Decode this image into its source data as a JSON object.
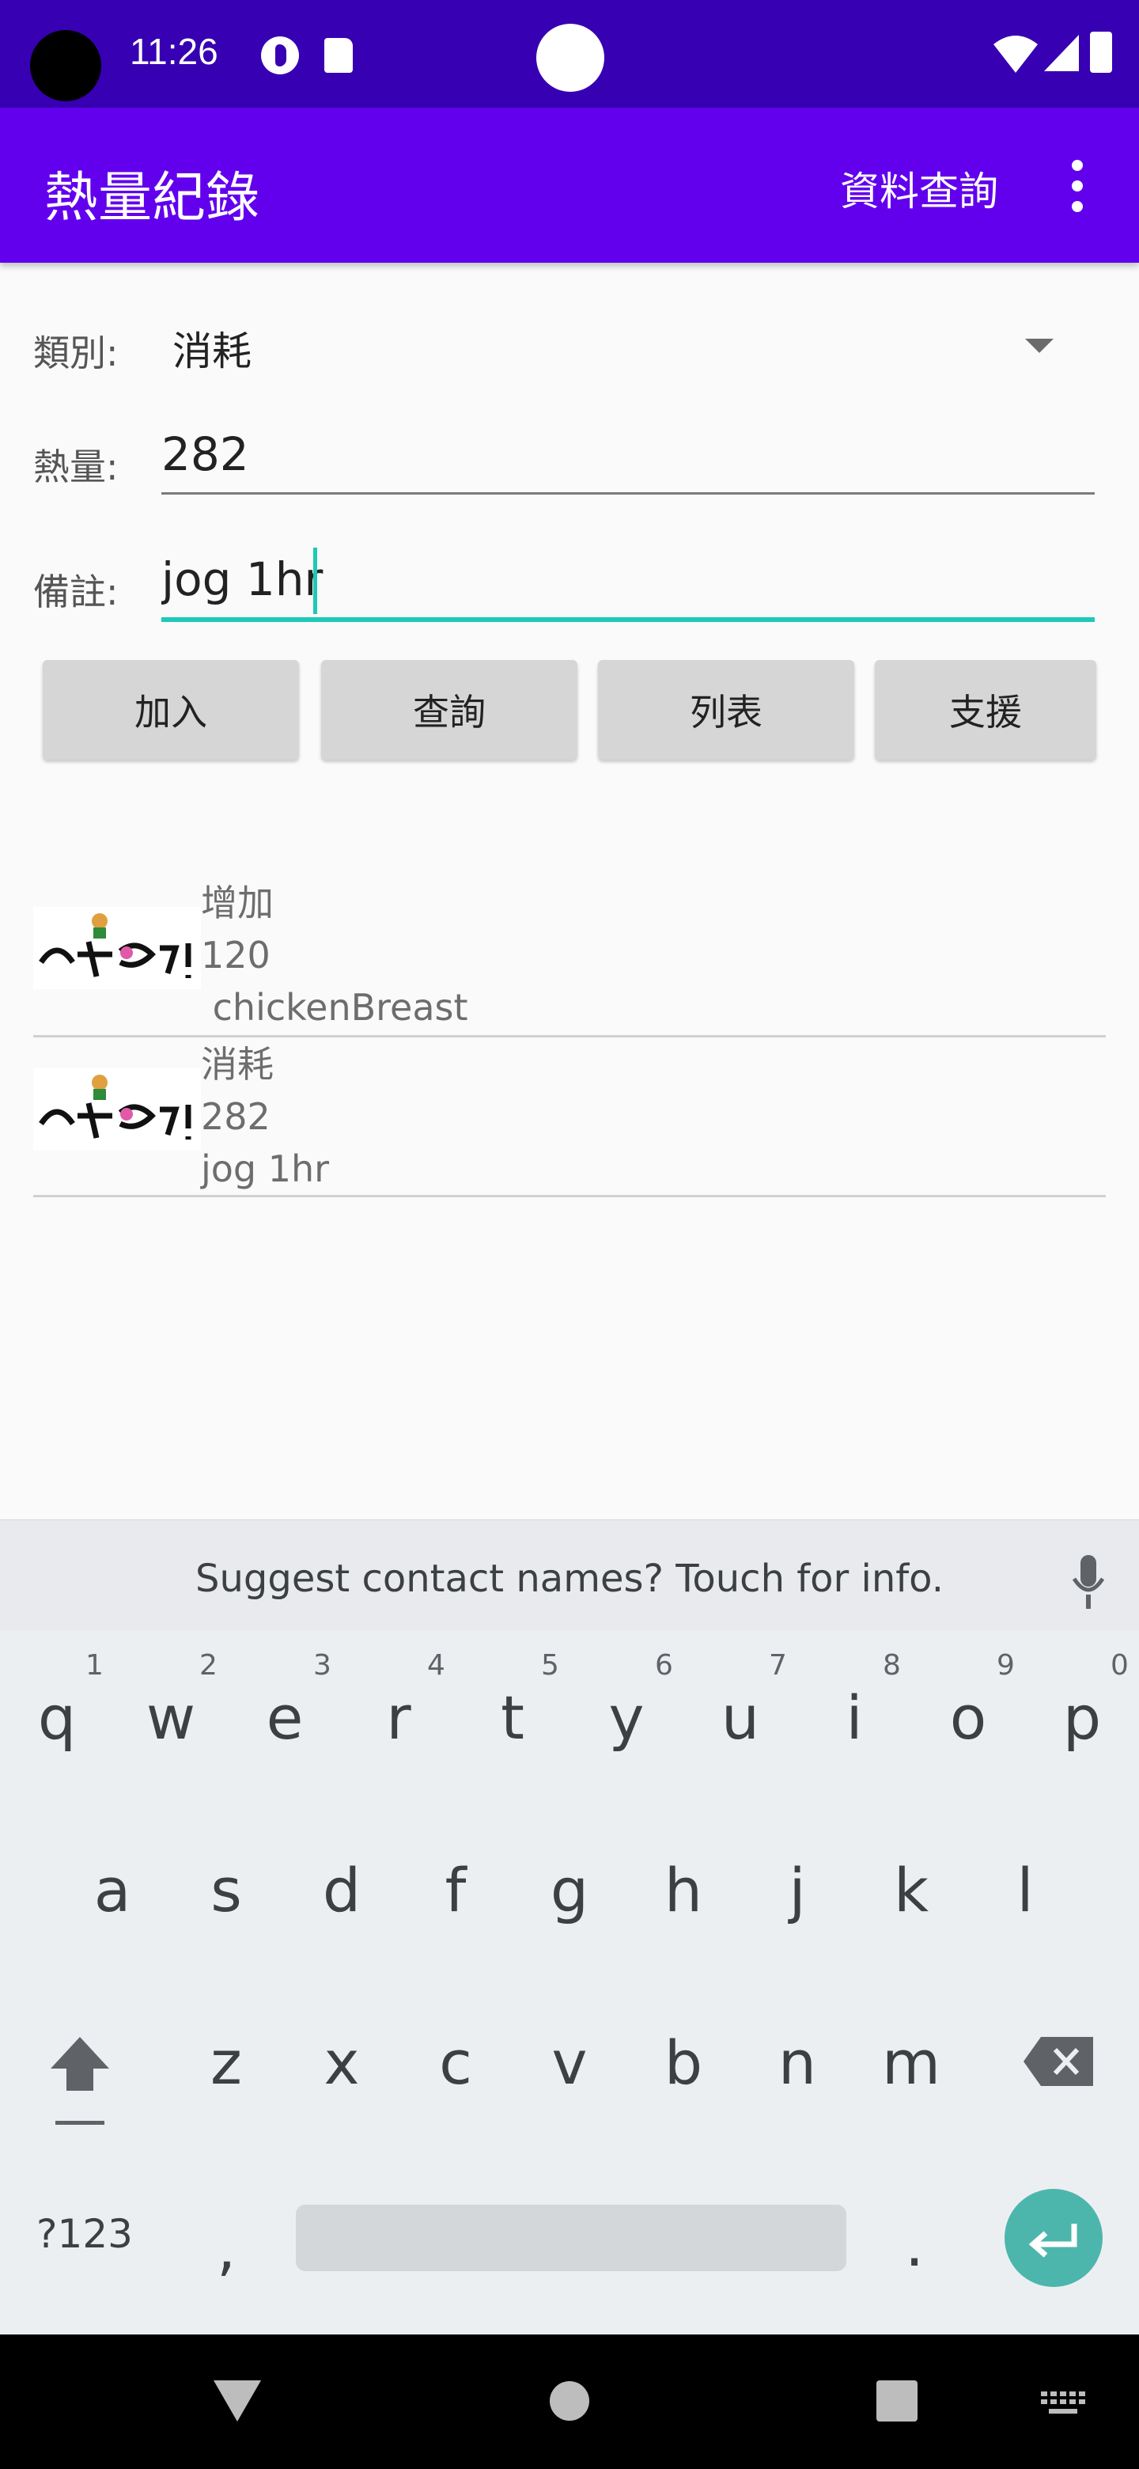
{
  "status_bar": {
    "time": "11:26"
  },
  "app_bar": {
    "title": "熱量紀錄",
    "action_label": "資料查詢"
  },
  "form": {
    "category_label": "類別:",
    "category_value": "消耗",
    "calories_label": "熱量:",
    "calories_value": "282",
    "note_label": "備註:",
    "note_value": "jog 1hr"
  },
  "buttons": {
    "add": "加入",
    "query": "查詢",
    "list": "列表",
    "support": "支援"
  },
  "records": [
    {
      "type": "增加",
      "calories": "120",
      "note": " chickenBreast"
    },
    {
      "type": "消耗",
      "calories": "282",
      "note": "jog 1hr"
    }
  ],
  "keyboard": {
    "suggestion": "Suggest contact names? Touch for info.",
    "row1": [
      "q",
      "w",
      "e",
      "r",
      "t",
      "y",
      "u",
      "i",
      "o",
      "p"
    ],
    "row1_hints": [
      "1",
      "2",
      "3",
      "4",
      "5",
      "6",
      "7",
      "8",
      "9",
      "0"
    ],
    "row2": [
      "a",
      "s",
      "d",
      "f",
      "g",
      "h",
      "j",
      "k",
      "l"
    ],
    "row3": [
      "z",
      "x",
      "c",
      "v",
      "b",
      "n",
      "m"
    ],
    "symbols_key": "?123",
    "comma_key": ",",
    "period_key": "."
  }
}
